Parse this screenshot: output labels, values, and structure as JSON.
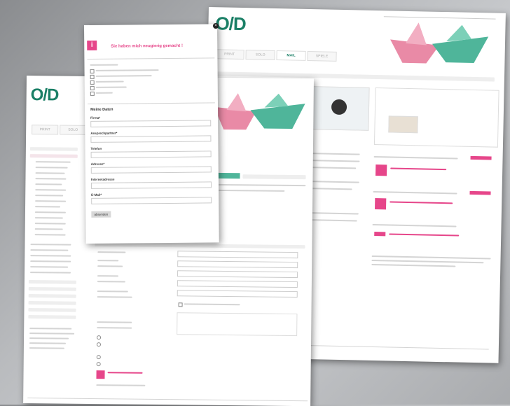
{
  "back_page": {
    "logo": "O/D",
    "tabs": [
      "PRINT",
      "SOLO",
      "MAIL",
      "SPIELE"
    ],
    "active_tab": "MAIL",
    "colors": {
      "accent": "#e6468a",
      "brand": "#1a7f66",
      "boat_pink": "#e98aa6",
      "boat_green": "#4fb59a"
    }
  },
  "front_popup": {
    "heading": "Sie haben mich neugierig gemacht !",
    "section_title": "Meine Daten",
    "fields": [
      "Firma*",
      "Ansprechpartner*",
      "Telefon",
      "Adresse*",
      "Internetadresse",
      "E-Mail*"
    ],
    "submit_label": "absenden",
    "icon": "info-icon"
  },
  "mid_page": {
    "logo": "O/D",
    "tabs": [
      "PRINT",
      "SOLO"
    ]
  }
}
